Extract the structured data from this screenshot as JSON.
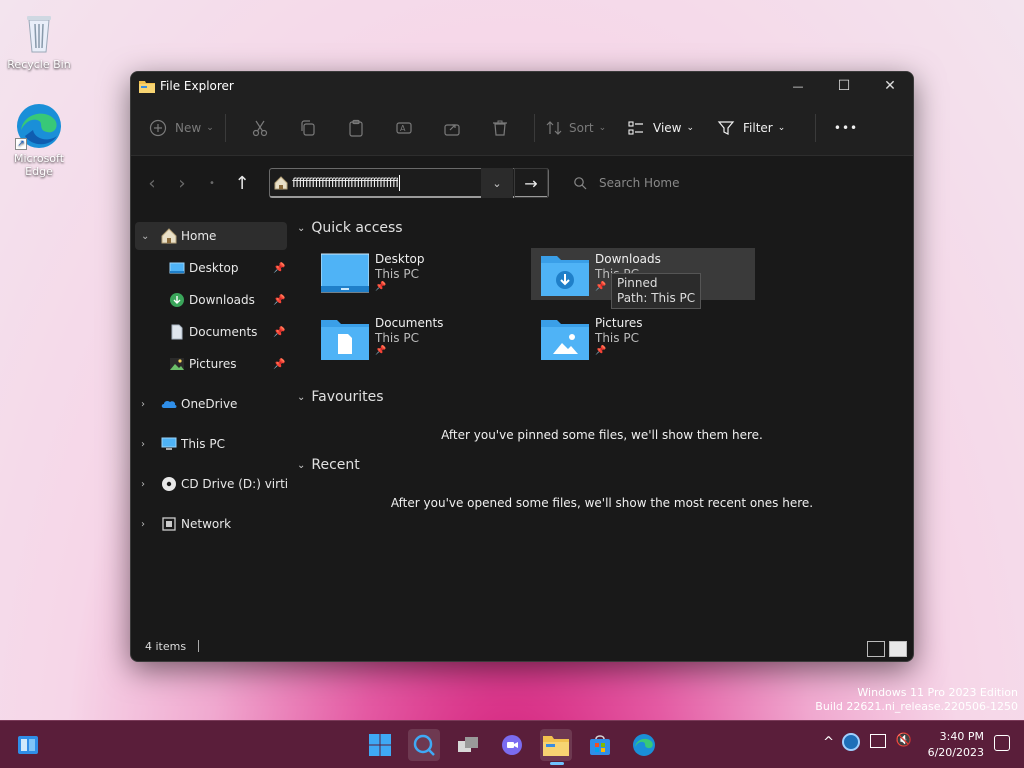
{
  "desktop": {
    "icons": [
      {
        "label": "Recycle Bin"
      },
      {
        "label": "Microsoft Edge"
      }
    ],
    "watermark_line1": "Windows 11 Pro 2023 Edition",
    "watermark_line2": "Build 22621.ni_release.220506-1250"
  },
  "window": {
    "title": "File Explorer",
    "controls": {
      "minimize": "—",
      "maximize": "☐",
      "close": "✕"
    }
  },
  "commandbar": {
    "new_label": "New",
    "sort_label": "Sort",
    "view_label": "View",
    "filter_label": "Filter",
    "more_label": "•••"
  },
  "address": {
    "value": "fffffffffffffffffffffffffffffffff",
    "search_placeholder": "Search Home"
  },
  "sidebar": {
    "items": [
      {
        "label": "Home"
      },
      {
        "label": "Desktop"
      },
      {
        "label": "Downloads"
      },
      {
        "label": "Documents"
      },
      {
        "label": "Pictures"
      },
      {
        "label": "OneDrive"
      },
      {
        "label": "This PC"
      },
      {
        "label": "CD Drive (D:) virtio-win"
      },
      {
        "label": "Network"
      }
    ]
  },
  "main": {
    "quick_access": {
      "heading": "Quick access",
      "tiles": [
        {
          "name": "Desktop",
          "location": "This PC"
        },
        {
          "name": "Downloads",
          "location": "This PC"
        },
        {
          "name": "Documents",
          "location": "This PC"
        },
        {
          "name": "Pictures",
          "location": "This PC"
        }
      ]
    },
    "favourites": {
      "heading": "Favourites",
      "empty": "After you've pinned some files, we'll show them here."
    },
    "recent": {
      "heading": "Recent",
      "empty": "After you've opened some files, we'll show the most recent ones here."
    },
    "tooltip": {
      "line1": "Pinned",
      "line2": "Path: This PC"
    }
  },
  "status": {
    "items_count": "4 items"
  },
  "taskbar": {
    "time": "3:40 PM",
    "date": "6/20/2023"
  },
  "colors": {
    "folder_blue": "#4fb3f6",
    "taskbar": "#5a1e3a",
    "window_bg": "#191919"
  }
}
